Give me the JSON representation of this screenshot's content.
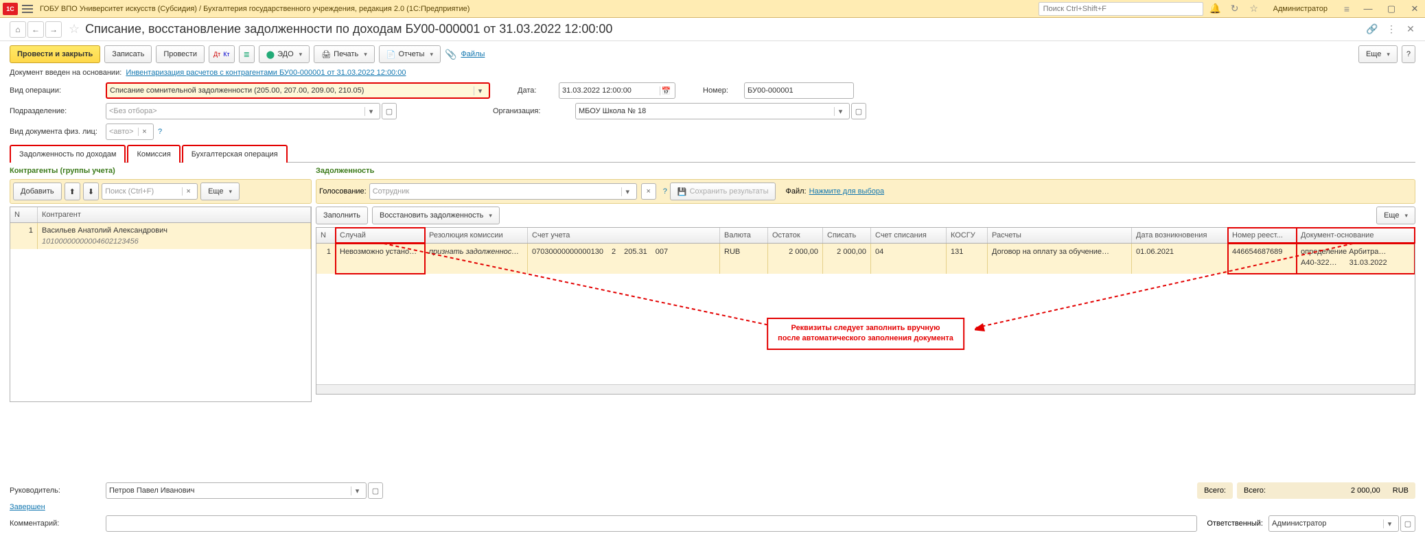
{
  "top": {
    "logo": "1С",
    "title": "ГОБУ ВПО Университет искусств (Субсидия) / Бухгалтерия государственного учреждения, редакция 2.0  (1С:Предприятие)",
    "search_ph": "Поиск Ctrl+Shift+F",
    "user": "Администратор"
  },
  "header": {
    "title": "Списание, восстановление задолженности по доходам БУ00-000001 от 31.03.2022 12:00:00"
  },
  "toolbar": {
    "post_close": "Провести и закрыть",
    "save": "Записать",
    "post": "Провести",
    "edo": "ЭДО",
    "print": "Печать",
    "reports": "Отчеты",
    "files": "Файлы",
    "more": "Еще",
    "help": "?"
  },
  "basis": {
    "label": "Документ введен на основании:",
    "link": "Инвентаризация расчетов с контрагентами БУ00-000001 от 31.03.2022 12:00:00"
  },
  "form": {
    "op_label": "Вид операции:",
    "op_value": "Списание сомнительной задолженности (205.00, 207.00, 209.00, 210.05)",
    "date_label": "Дата:",
    "date_value": "31.03.2022 12:00:00",
    "num_label": "Номер:",
    "num_value": "БУ00-000001",
    "dept_label": "Подразделение:",
    "dept_ph": "<Без отбора>",
    "org_label": "Организация:",
    "org_value": "МБОУ Школа № 18",
    "doctype_label": "Вид документа физ. лиц:",
    "doctype_ph": "<авто>"
  },
  "tabs": {
    "t1": "Задолженность по доходам",
    "t2": "Комиссия",
    "t3": "Бухгалтерская операция"
  },
  "left": {
    "title": "Контрагенты (группы учета)",
    "add": "Добавить",
    "search_ph": "Поиск (Ctrl+F)",
    "more": "Еще",
    "col_n": "N",
    "col_name": "Контрагент",
    "row_n": "1",
    "row_name": "Васильев Анатолий Александрович",
    "row_code": "10100000000004602123456"
  },
  "right": {
    "title": "Задолженность",
    "vote_label": "Голосование:",
    "vote_ph": "Сотрудник",
    "save_res_ic": "💾",
    "save_res": "Сохранить результаты",
    "file_label": "Файл:",
    "file_link": "Нажмите для выбора",
    "fill": "Заполнить",
    "restore": "Восстановить задолженность",
    "more": "Еще",
    "cols": {
      "n": "N",
      "case": "Случай",
      "res": "Резолюция комиссии",
      "acc": "Счет учета",
      "cur": "Валюта",
      "bal": "Остаток",
      "writeoff": "Списать",
      "wacc": "Счет списания",
      "kosgu": "КОСГУ",
      "calc": "Расчеты",
      "ddate": "Дата возникновения",
      "reg": "Номер реест...",
      "doc": "Документ-основание"
    },
    "row": {
      "n": "1",
      "case": "Невозможно установить …",
      "res": "признать задолженность …",
      "acc1": "07030000000000130",
      "acc2": "2",
      "acc3": "205.31",
      "acc4": "007",
      "cur": "RUB",
      "bal": "2 000,00",
      "writeoff": "2 000,00",
      "wacc": "04",
      "kosgu": "131",
      "calc": "Договор на оплату за обучение…",
      "ddate": "01.06.2021",
      "reg": "446654687689",
      "doc1": "определение Арбитра…",
      "doc2": "А40-322…",
      "doc3": "31.03.2022"
    }
  },
  "anno": {
    "l1": "Реквизиты следует заполнить вручную",
    "l2": "после автоматического заполнения документа"
  },
  "footer": {
    "chief_label": "Руководитель:",
    "chief_value": "Петров Павел Иванович",
    "done": "Завершен",
    "comment_label": "Комментарий:",
    "resp_label": "Ответственный:",
    "resp_value": "Администратор",
    "total": "Всего:",
    "total_val": "2 000,00",
    "total_cur": "RUB"
  }
}
